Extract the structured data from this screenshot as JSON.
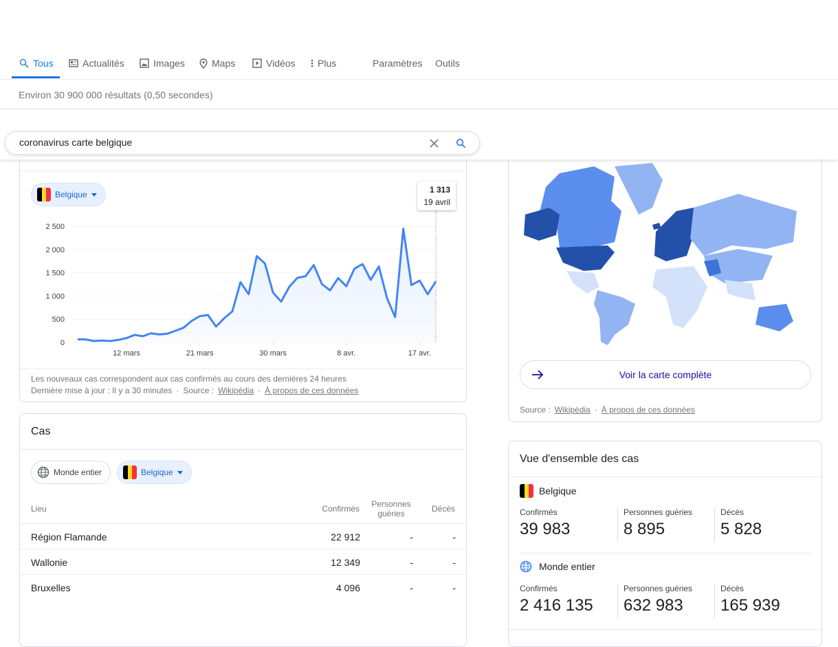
{
  "nav": {
    "tabs": [
      {
        "label": "Tous",
        "icon": "search-icon",
        "active": true
      },
      {
        "label": "Actualités",
        "icon": "news-icon"
      },
      {
        "label": "Images",
        "icon": "image-icon"
      },
      {
        "label": "Maps",
        "icon": "map-pin-icon"
      },
      {
        "label": "Vidéos",
        "icon": "play-icon"
      },
      {
        "label": "Plus",
        "icon": "more-vert-icon"
      }
    ],
    "settings": "Paramètres",
    "tools": "Outils"
  },
  "results_stats": "Environ 30 900 000 résultats (0,50 secondes)",
  "search": {
    "value": "coronavirus carte belgique"
  },
  "new_cases": {
    "country_select": "Belgique",
    "tooltip": {
      "value": "1 313",
      "date": "19 avril"
    },
    "note": "Les nouveaux cas correspondent aux cas confirmés au cours des dernières 24 heures",
    "updated": "Dernière mise à jour : Il y a 30 minutes",
    "source_label": "Source :",
    "source_link": "Wikipédia",
    "about_link": "À propos de ces données"
  },
  "chart_data": {
    "type": "area",
    "x": [
      "6 mars",
      "7 mars",
      "8 mars",
      "9 mars",
      "10 mars",
      "11 mars",
      "12 mars",
      "13 mars",
      "14 mars",
      "15 mars",
      "16 mars",
      "17 mars",
      "18 mars",
      "19 mars",
      "20 mars",
      "21 mars",
      "22 mars",
      "23 mars",
      "24 mars",
      "25 mars",
      "26 mars",
      "27 mars",
      "28 mars",
      "29 mars",
      "30 mars",
      "31 mars",
      "1 avr.",
      "2 avr.",
      "3 avr.",
      "4 avr.",
      "5 avr.",
      "6 avr.",
      "7 avr.",
      "8 avr.",
      "9 avr.",
      "10 avr.",
      "11 avr.",
      "12 avr.",
      "13 avr.",
      "14 avr.",
      "15 avr.",
      "16 avr.",
      "17 avr.",
      "18 avr.",
      "19 avr."
    ],
    "values": [
      64,
      64,
      30,
      40,
      30,
      55,
      93,
      162,
      133,
      196,
      172,
      186,
      250,
      315,
      462,
      565,
      590,
      340,
      520,
      668,
      1297,
      1036,
      1857,
      1700,
      1071,
      879,
      1198,
      1390,
      1424,
      1665,
      1257,
      1120,
      1385,
      1208,
      1586,
      1685,
      1346,
      1635,
      953,
      545,
      2446,
      1233,
      1331,
      1036,
      1313
    ],
    "yticks": [
      "0",
      "500",
      "1 000",
      "1 500",
      "2 000",
      "2 500"
    ],
    "ytick_values": [
      0,
      500,
      1000,
      1500,
      2000,
      2500
    ],
    "xticks": [
      {
        "label": "12 mars",
        "index": 6
      },
      {
        "label": "21 mars",
        "index": 15
      },
      {
        "label": "30 mars",
        "index": 24
      },
      {
        "label": "8 avr.",
        "index": 33
      },
      {
        "label": "17 avr.",
        "index": 42
      }
    ],
    "ylim": [
      0,
      2500
    ],
    "grid": true,
    "color": "#4285f4"
  },
  "cases": {
    "title": "Cas",
    "world_pill": "Monde entier",
    "country_pill": "Belgique",
    "headers": {
      "place": "Lieu",
      "confirmed": "Confirmés",
      "recovered": "Personnes guéries",
      "deaths": "Décès"
    },
    "rows": [
      {
        "place": "Région Flamande",
        "confirmed": "22 912",
        "recovered": "-",
        "deaths": "-"
      },
      {
        "place": "Wallonie",
        "confirmed": "12 349",
        "recovered": "-",
        "deaths": "-"
      },
      {
        "place": "Bruxelles",
        "confirmed": "4 096",
        "recovered": "-",
        "deaths": "-"
      }
    ]
  },
  "map": {
    "button": "Voir la carte complète",
    "source_label": "Source :",
    "source_link": "Wikipédia",
    "about_link": "À propos de ces données",
    "colors": {
      "darkest": "#2350a8",
      "dark": "#3f74d6",
      "mid": "#5b8ded",
      "light": "#92b4f2",
      "lightest": "#d3e2fa"
    }
  },
  "overview": {
    "title": "Vue d'ensemble des cas",
    "sections": [
      {
        "name": "Belgique",
        "confirmed_label": "Confirmés",
        "confirmed": "39 983",
        "recovered_label": "Personnes guéries",
        "recovered": "8 895",
        "deaths_label": "Décès",
        "deaths": "5 828"
      },
      {
        "name": "Monde entier",
        "confirmed_label": "Confirmés",
        "confirmed": "2 416 135",
        "recovered_label": "Personnes guéries",
        "recovered": "632 983",
        "deaths_label": "Décès",
        "deaths": "165 939"
      }
    ]
  }
}
